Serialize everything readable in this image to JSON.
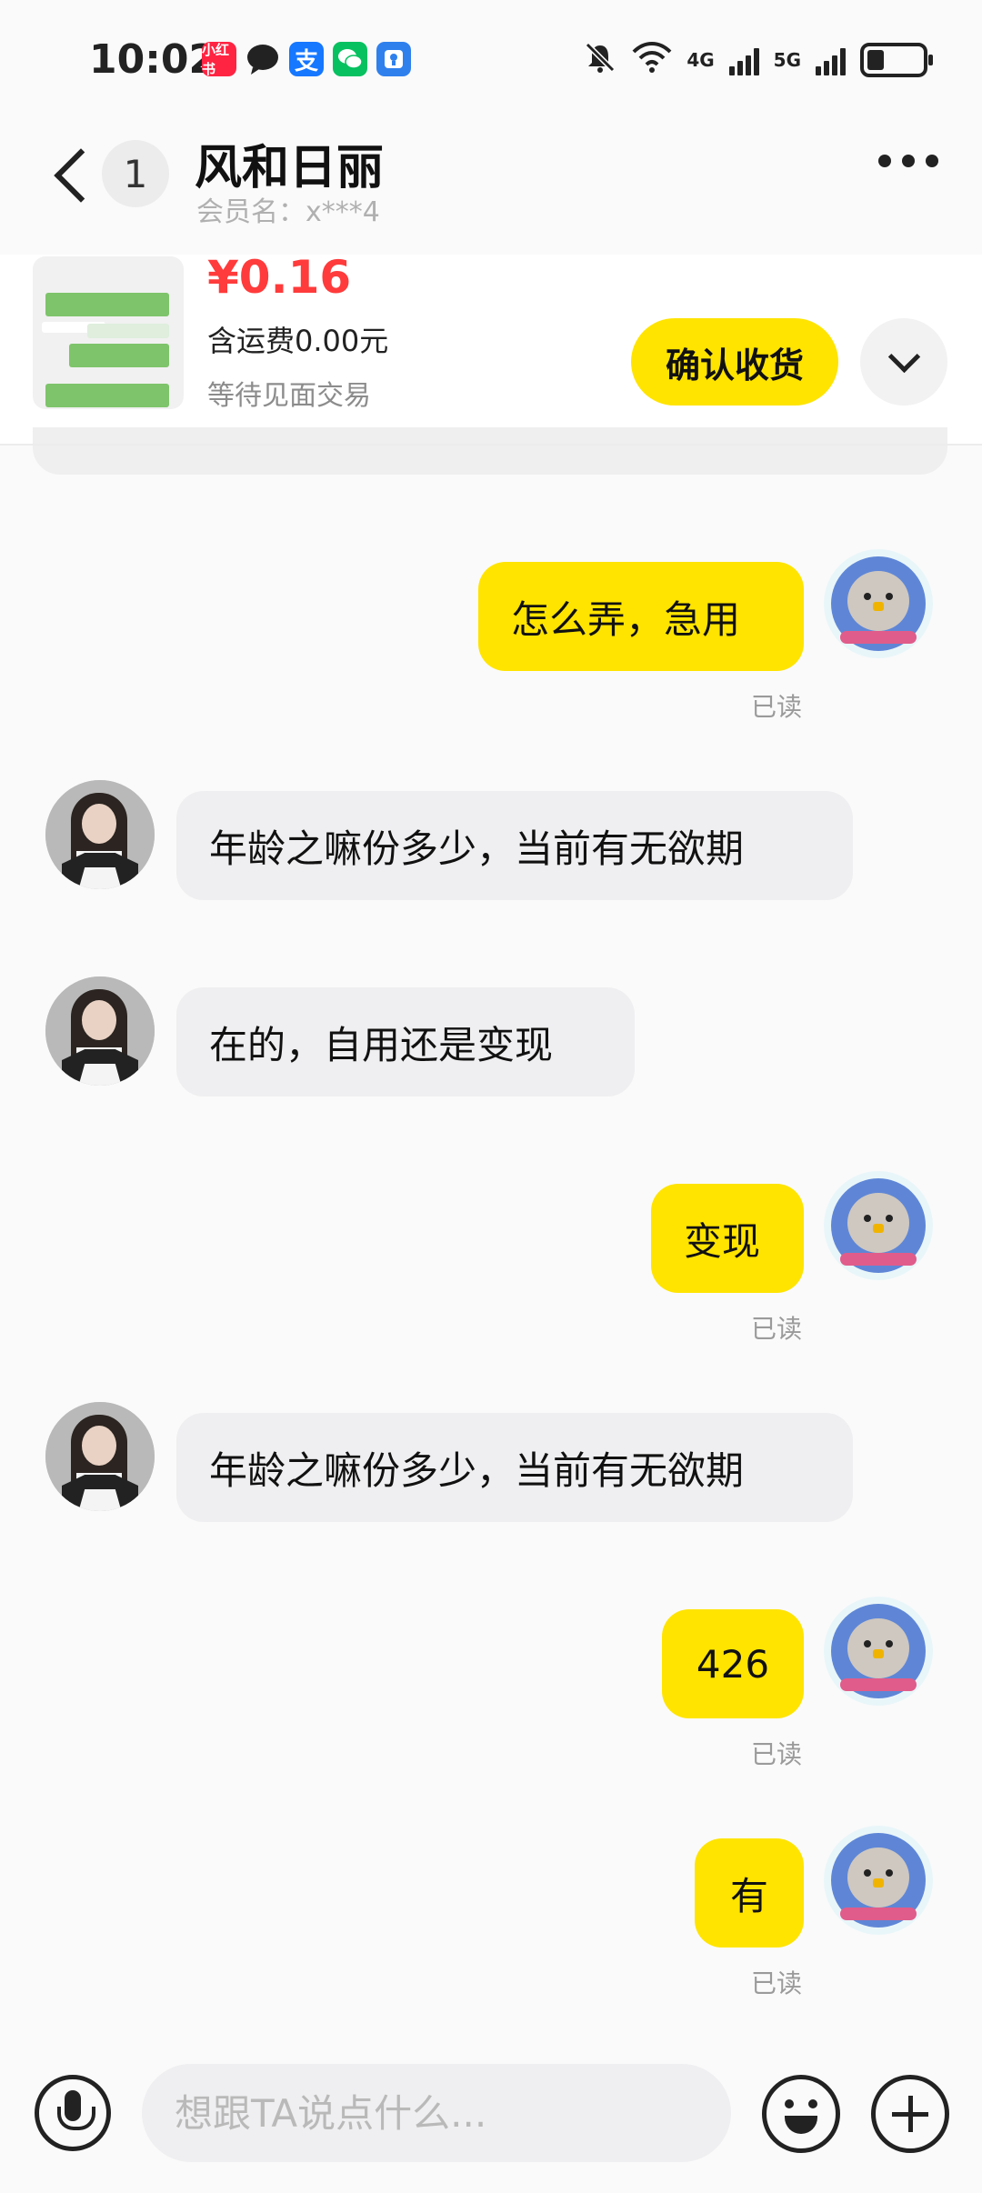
{
  "status_bar": {
    "time": "10:02",
    "app_icons": [
      "xiaohongshu-icon",
      "message-icon",
      "alipay-icon",
      "wechat-icon",
      "blue-app-icon"
    ],
    "xiaohongshu_text": "小红书",
    "alipay_text": "支",
    "network_4g": "4G",
    "network_5g": "5G"
  },
  "header": {
    "unread_count": "1",
    "title": "风和日丽",
    "member_name": "会员名：x***4"
  },
  "product": {
    "price": "¥0.16",
    "shipping": "含运费0.00元",
    "status": "等待见面交易",
    "confirm_label": "确认收货"
  },
  "messages": [
    {
      "from": "me",
      "text": "怎么弄，急用",
      "read": "已读"
    },
    {
      "from": "her",
      "text": "年龄之嘛份多少，当前有无欲期"
    },
    {
      "from": "her",
      "text": "在的，自用还是变现"
    },
    {
      "from": "me",
      "text": "变现",
      "read": "已读"
    },
    {
      "from": "her",
      "text": "年龄之嘛份多少，当前有无欲期"
    },
    {
      "from": "me",
      "text": "426",
      "read": "已读"
    },
    {
      "from": "me",
      "text": "有",
      "read": "已读"
    }
  ],
  "input": {
    "placeholder": "想跟TA说点什么..."
  },
  "colors": {
    "accent": "#ffe400",
    "price": "#ff3b3b"
  }
}
